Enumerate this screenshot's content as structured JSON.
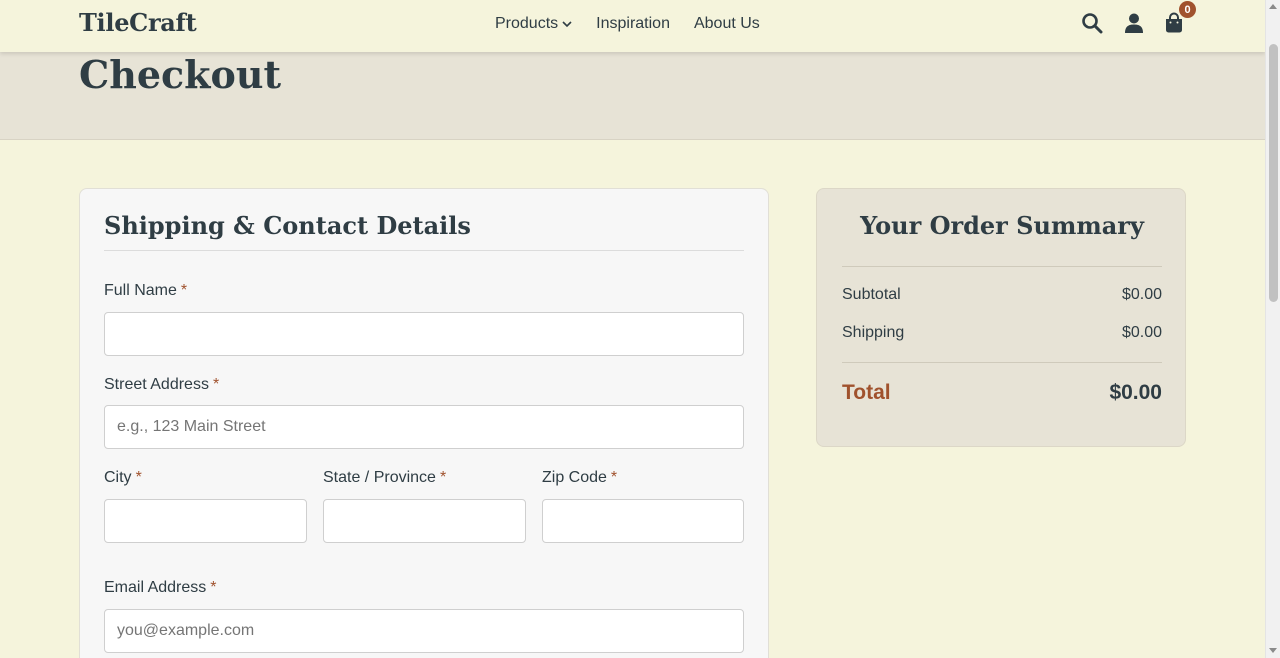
{
  "header": {
    "brand": "TileCraft",
    "nav": [
      "Products",
      "Inspiration",
      "About Us"
    ],
    "cart_count": "0"
  },
  "hero": {
    "title": "Checkout"
  },
  "form": {
    "title": "Shipping & Contact Details",
    "required_mark": "*",
    "full_name": {
      "label": "Full Name",
      "value": "",
      "placeholder": ""
    },
    "street": {
      "label": "Street Address",
      "value": "",
      "placeholder": "e.g., 123 Main Street"
    },
    "city": {
      "label": "City",
      "value": "",
      "placeholder": ""
    },
    "state": {
      "label": "State / Province",
      "value": "",
      "placeholder": ""
    },
    "zip": {
      "label": "Zip Code",
      "value": "",
      "placeholder": ""
    },
    "email": {
      "label": "Email Address",
      "value": "",
      "placeholder": "you@example.com"
    }
  },
  "summary": {
    "title": "Your Order Summary",
    "subtotal_label": "Subtotal",
    "subtotal_value": "$0.00",
    "shipping_label": "Shipping",
    "shipping_value": "$0.00",
    "total_label": "Total",
    "total_value": "$0.00"
  },
  "colors": {
    "accent": "#a0522d",
    "background": "#f5f4dc",
    "text": "#2f3d44"
  },
  "icons": [
    "search-icon",
    "user-icon",
    "shopping-bag-icon",
    "chevron-down-icon"
  ]
}
